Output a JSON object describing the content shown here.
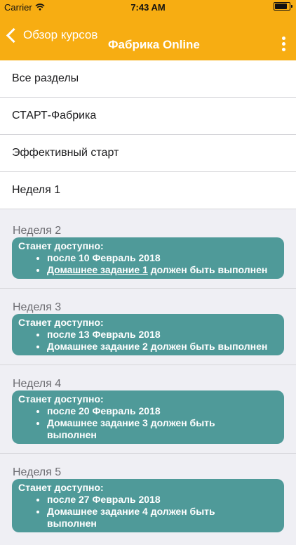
{
  "status_bar": {
    "carrier": "Carrier",
    "time": "7:43 AM",
    "battery_level": 0.95
  },
  "nav": {
    "back_label": "Обзор курсов",
    "title": "Фабрика Online"
  },
  "menu": [
    "Все разделы",
    "СТАРТ-Фабрика",
    "Эффективный старт",
    "Неделя 1"
  ],
  "weeks": [
    {
      "title": "Неделя 2",
      "notice_title": "Станет доступно:",
      "date": "после 10 Февраль 2018",
      "task_link": "Домашнее задание 1",
      "task_rest": " должен быть выполнен"
    },
    {
      "title": "Неделя 3",
      "notice_title": "Станет доступно:",
      "date": "после 13 Февраль 2018",
      "task_text": "Домашнее задание 2 должен быть выполнен"
    },
    {
      "title": "Неделя 4",
      "notice_title": "Станет доступно:",
      "date": "после 20 Февраль 2018",
      "task_text": "Домашнее задание 3 должен быть выполнен"
    },
    {
      "title": "Неделя 5",
      "notice_title": "Станет доступно:",
      "date": "после 27 Февраль 2018",
      "task_text": "Домашнее задание 4 должен быть выполнен"
    }
  ],
  "colors": {
    "accent": "#f7ad12",
    "notice": "#4f9a99",
    "background": "#efeff4"
  }
}
